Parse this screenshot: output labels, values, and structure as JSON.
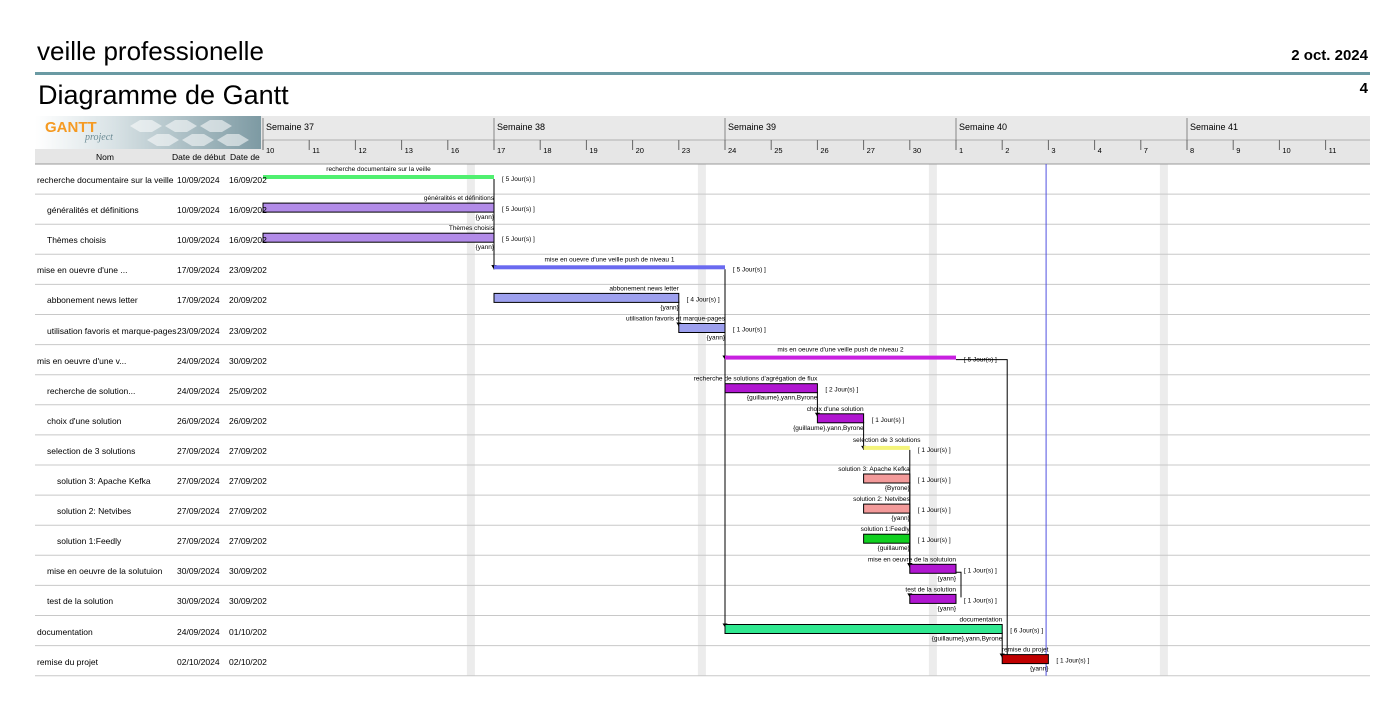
{
  "page": {
    "project_title": "veille professionelle",
    "date": "2 oct. 2024",
    "page_number": "4",
    "diagram_title": "Diagramme de Gantt"
  },
  "logo": {
    "main": "GANTT",
    "sub": "project"
  },
  "table": {
    "headers": {
      "name": "Nom",
      "start": "Date de début",
      "end": "Date de"
    },
    "rows": [
      {
        "name": "recherche documentaire sur la veille",
        "start": "10/09/2024",
        "end": "16/09/202",
        "indent": 0
      },
      {
        "name": "généralités et définitions",
        "start": "10/09/2024",
        "end": "16/09/202",
        "indent": 1
      },
      {
        "name": "Thèmes choisis",
        "start": "10/09/2024",
        "end": "16/09/202",
        "indent": 1
      },
      {
        "name": "mise en ouevre d'une ...",
        "start": "17/09/2024",
        "end": "23/09/202",
        "indent": 0
      },
      {
        "name": "abbonement news letter",
        "start": "17/09/2024",
        "end": "20/09/202",
        "indent": 1
      },
      {
        "name": "utilisation favoris et marque-pages",
        "start": "23/09/2024",
        "end": "23/09/202",
        "indent": 1
      },
      {
        "name": "mis en oeuvre d'une v...",
        "start": "24/09/2024",
        "end": "30/09/202",
        "indent": 0
      },
      {
        "name": "recherche de solution...",
        "start": "24/09/2024",
        "end": "25/09/202",
        "indent": 1
      },
      {
        "name": "choix d'une solution",
        "start": "26/09/2024",
        "end": "26/09/202",
        "indent": 1
      },
      {
        "name": "selection de 3 solutions",
        "start": "27/09/2024",
        "end": "27/09/202",
        "indent": 1
      },
      {
        "name": "solution 3: Apache Kefka",
        "start": "27/09/2024",
        "end": "27/09/202",
        "indent": 2
      },
      {
        "name": "solution 2: Netvibes",
        "start": "27/09/2024",
        "end": "27/09/202",
        "indent": 2
      },
      {
        "name": "solution 1:Feedly",
        "start": "27/09/2024",
        "end": "27/09/202",
        "indent": 2
      },
      {
        "name": "mise en oeuvre de la solutuion",
        "start": "30/09/2024",
        "end": "30/09/202",
        "indent": 1
      },
      {
        "name": "test de la solution",
        "start": "30/09/2024",
        "end": "30/09/202",
        "indent": 1
      },
      {
        "name": "documentation",
        "start": "24/09/2024",
        "end": "01/10/202",
        "indent": 0
      },
      {
        "name": "remise du projet",
        "start": "02/10/2024",
        "end": "02/10/202",
        "indent": 0
      }
    ]
  },
  "chart_data": {
    "type": "gantt",
    "weeks": [
      "Semaine 37",
      "Semaine 38",
      "Semaine 39",
      "Semaine 40",
      "Semaine 41"
    ],
    "day_labels": [
      "10",
      "11",
      "12",
      "13",
      "16",
      "17",
      "18",
      "19",
      "20",
      "23",
      "24",
      "25",
      "26",
      "27",
      "30",
      "1",
      "2",
      "3",
      "4",
      "7",
      "8",
      "9",
      "10",
      "11"
    ],
    "today_index": 16.95,
    "tasks": [
      {
        "label": "recherche documentaire sur la veille",
        "start": 0,
        "end": 5,
        "duration": "[ 5 Jour(s) ]",
        "resources": "",
        "color": "#50f070",
        "summary": true
      },
      {
        "label": "généralités et définitions",
        "start": 0,
        "end": 5,
        "duration": "[ 5 Jour(s) ]",
        "resources": "{yann}",
        "color": "#b28be8"
      },
      {
        "label": "Thèmes choisis",
        "start": 0,
        "end": 5,
        "duration": "[ 5 Jour(s) ]",
        "resources": "{yann}",
        "color": "#b28be8"
      },
      {
        "label": "mise en ouevre d'une veille push de niveau 1",
        "start": 5,
        "end": 10,
        "duration": "[ 5 Jour(s) ]",
        "resources": "",
        "color": "#6a6af0",
        "summary": true
      },
      {
        "label": "abbonement news letter",
        "start": 5,
        "end": 9,
        "duration": "[ 4 Jour(s) ]",
        "resources": "{yann}",
        "color": "#9da0ee"
      },
      {
        "label": "utilisation favoris et marque-pages",
        "start": 9,
        "end": 10,
        "duration": "[ 1 Jour(s) ]",
        "resources": "{yann}",
        "color": "#9da0ee"
      },
      {
        "label": "mis en oeuvre d'une veille push de niveau 2",
        "start": 10,
        "end": 15,
        "duration": "[ 5 Jour(s) ]",
        "resources": "",
        "color": "#c820e0",
        "summary": true
      },
      {
        "label": "recherche de solutions d'agrégation de flux",
        "start": 10,
        "end": 12,
        "duration": "[ 2 Jour(s) ]",
        "resources": "{guillaume},yann,Byrone",
        "color": "#b016d0"
      },
      {
        "label": "choix d'une solution",
        "start": 12,
        "end": 13,
        "duration": "[ 1 Jour(s) ]",
        "resources": "{guillaume},yann,Byrone",
        "color": "#b016d0"
      },
      {
        "label": "selection de 3 solutions",
        "start": 13,
        "end": 14,
        "duration": "[ 1 Jour(s) ]",
        "resources": "",
        "color": "#f4f47a",
        "summary": true
      },
      {
        "label": "solution 3: Apache Kefka",
        "start": 13,
        "end": 14,
        "duration": "[ 1 Jour(s) ]",
        "resources": "{Byrone}",
        "color": "#f39a9a"
      },
      {
        "label": "solution 2: Netvibes",
        "start": 13,
        "end": 14,
        "duration": "[ 1 Jour(s) ]",
        "resources": "{yann}",
        "color": "#f39a9a"
      },
      {
        "label": "solution 1:Feedly",
        "start": 13,
        "end": 14,
        "duration": "[ 1 Jour(s) ]",
        "resources": "{guillaume}",
        "color": "#10d020"
      },
      {
        "label": "mise en oeuvre de la solutuion",
        "start": 14,
        "end": 15,
        "duration": "[ 1 Jour(s) ]",
        "resources": "{yann}",
        "color": "#b016d0"
      },
      {
        "label": "test de la solution",
        "start": 14,
        "end": 15,
        "duration": "[ 1 Jour(s) ]",
        "resources": "{yann}",
        "color": "#b016d0"
      },
      {
        "label": "documentation",
        "start": 10,
        "end": 16,
        "duration": "[ 6 Jour(s) ]",
        "resources": "{guillaume},yann,Byrone",
        "color": "#30e890"
      },
      {
        "label": "remise du projet",
        "start": 16,
        "end": 17,
        "duration": "[ 1 Jour(s) ]",
        "resources": "{yann}",
        "color": "#c00000"
      }
    ],
    "dependencies": [
      [
        0,
        3
      ],
      [
        1,
        3
      ],
      [
        2,
        3
      ],
      [
        4,
        5
      ],
      [
        3,
        6
      ],
      [
        5,
        6
      ],
      [
        5,
        15
      ],
      [
        7,
        8
      ],
      [
        8,
        9
      ],
      [
        9,
        13
      ],
      [
        10,
        13
      ],
      [
        11,
        13
      ],
      [
        12,
        13
      ],
      [
        13,
        14
      ],
      [
        6,
        16
      ],
      [
        15,
        16
      ]
    ]
  }
}
